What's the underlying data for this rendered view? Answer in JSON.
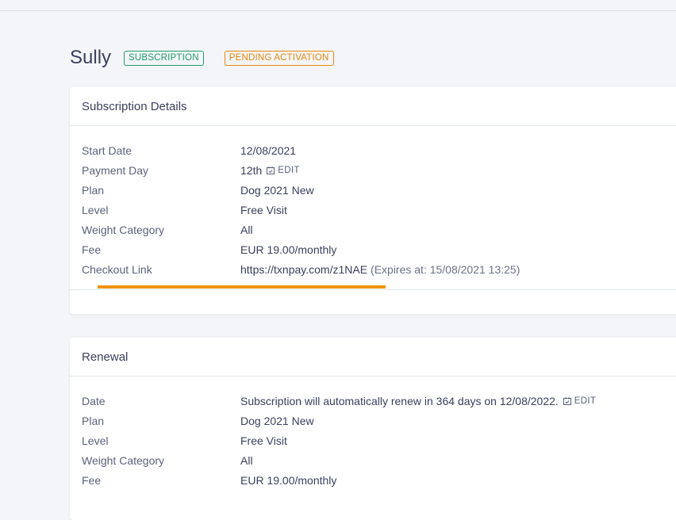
{
  "header": {
    "title": "Sully",
    "badges": [
      "SUBSCRIPTION",
      "PENDING ACTIVATION"
    ]
  },
  "details": {
    "heading": "Subscription Details",
    "rows": [
      {
        "label": "Start Date",
        "value": "12/08/2021"
      },
      {
        "label": "Payment Day",
        "value": "12th",
        "action": "EDIT"
      },
      {
        "label": "Plan",
        "value": "Dog 2021 New"
      },
      {
        "label": "Level",
        "value": "Free Visit"
      },
      {
        "label": "Weight Category",
        "value": "All"
      },
      {
        "label": "Fee",
        "value": "EUR 19.00/monthly"
      },
      {
        "label": "Checkout Link",
        "value": "https://txnpay.com/z1NAE",
        "note": "(Expires at: 15/08/2021 13:25)"
      }
    ],
    "progress": 1.0
  },
  "renewal": {
    "heading": "Renewal",
    "rows": [
      {
        "label": "Date",
        "value": "Subscription will automatically renew in 364 days on 12/08/2022.",
        "action": "EDIT"
      },
      {
        "label": "Plan",
        "value": "Dog 2021 New"
      },
      {
        "label": "Level",
        "value": "Free Visit"
      },
      {
        "label": "Weight Category",
        "value": "All"
      },
      {
        "label": "Fee",
        "value": "EUR 19.00/monthly"
      }
    ]
  },
  "colors": {
    "success": "#1f9d6a",
    "warning": "#e8870d",
    "progress": "#f0930f"
  },
  "icons": {
    "edit": "calendar-edit-icon"
  }
}
